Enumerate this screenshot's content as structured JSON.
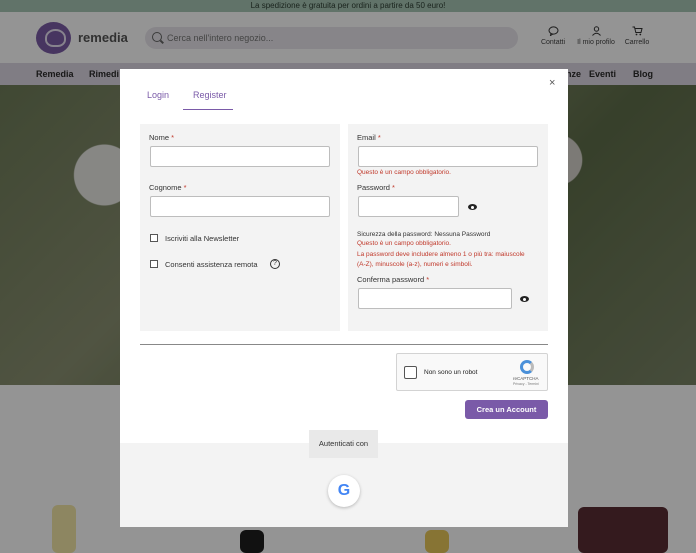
{
  "promo_bar": {
    "text": "La spedizione è gratuita per ordini a partire da 50 euro!"
  },
  "header": {
    "brand": "remedia",
    "search_placeholder": "Cerca nell'intero negozio...",
    "links": {
      "contacts": "Contatti",
      "profile": "Il mio profilo",
      "cart": "Carrello"
    }
  },
  "nav": {
    "items": [
      "Remedia",
      "Rimedi",
      "nze",
      "Eventi",
      "Blog"
    ]
  },
  "modal": {
    "close_symbol": "×",
    "tabs": {
      "login": "Login",
      "register": "Register"
    },
    "active_tab": "Register",
    "left": {
      "nome_label": "Nome",
      "cognome_label": "Cognome",
      "required_mark": "*",
      "newsletter_label": "Iscriviti alla Newsletter",
      "assist_label": "Consenti assistenza remota",
      "help_symbol": "?"
    },
    "right": {
      "email_label": "Email",
      "email_error": "Questo è un campo obbligatorio.",
      "password_label": "Password",
      "strength_text": "Sicurezza della password: Nessuna Password",
      "password_error": "Questo è un campo obbligatorio.",
      "password_rule_1": "La password deve includere almeno 1 o più tra: maiuscole",
      "password_rule_2": "(A-Z), minuscole (a-z), numeri e simboli.",
      "confirm_label": "Conferma password"
    },
    "recaptcha": {
      "text": "Non sono un robot",
      "brand": "reCAPTCHA",
      "terms": "Privacy - Termini"
    },
    "create_button": "Crea un Account",
    "auth_label": "Autenticati con",
    "google_letter": "G"
  },
  "colors": {
    "accent": "#7a5aa8",
    "error": "#c0392b",
    "promo_bg": "#a8c6b5"
  }
}
